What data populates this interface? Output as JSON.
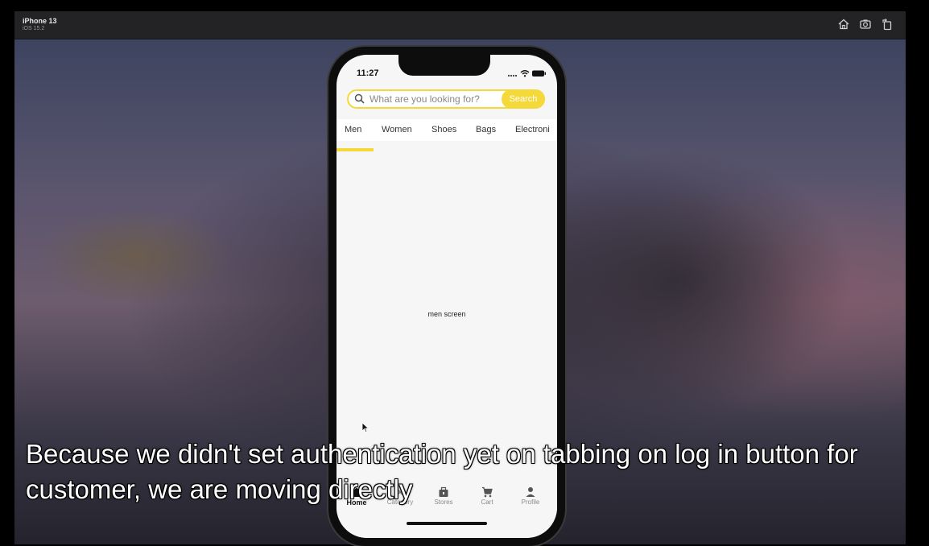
{
  "simulator": {
    "device_name": "iPhone 13",
    "os_version": "iOS 15.2",
    "buttons": [
      {
        "icon": "home-icon"
      },
      {
        "icon": "screenshot-icon"
      },
      {
        "icon": "rotate-icon"
      }
    ]
  },
  "status_bar": {
    "time": "11:27",
    "icons": [
      "cellular-icon",
      "wifi-icon",
      "battery-icon"
    ]
  },
  "search": {
    "placeholder": "What are you looking for?",
    "button_label": "Search",
    "icon": "search-icon"
  },
  "tabs": [
    {
      "label": "Men",
      "selected": true
    },
    {
      "label": "Women",
      "selected": false
    },
    {
      "label": "Shoes",
      "selected": false
    },
    {
      "label": "Bags",
      "selected": false
    },
    {
      "label": "Electroni",
      "selected": false
    }
  ],
  "content": {
    "label": "men screen"
  },
  "bottom_nav": [
    {
      "label": "Home",
      "icon": "home-icon",
      "active": true
    },
    {
      "label": "Category",
      "icon": "category-icon",
      "active": false
    },
    {
      "label": "Stores",
      "icon": "store-icon",
      "active": false
    },
    {
      "label": "Cart",
      "icon": "cart-icon",
      "active": false
    },
    {
      "label": "Profile",
      "icon": "profile-icon",
      "active": false
    }
  ],
  "subtitle": {
    "line1": "Because we didn't set authentication yet on tabbing on log in button for",
    "line2": "customer, we are moving directly"
  },
  "colors": {
    "accent": "#f5d93a",
    "screen_background": "#f6f6f6",
    "simulator_bar": "#232325"
  }
}
